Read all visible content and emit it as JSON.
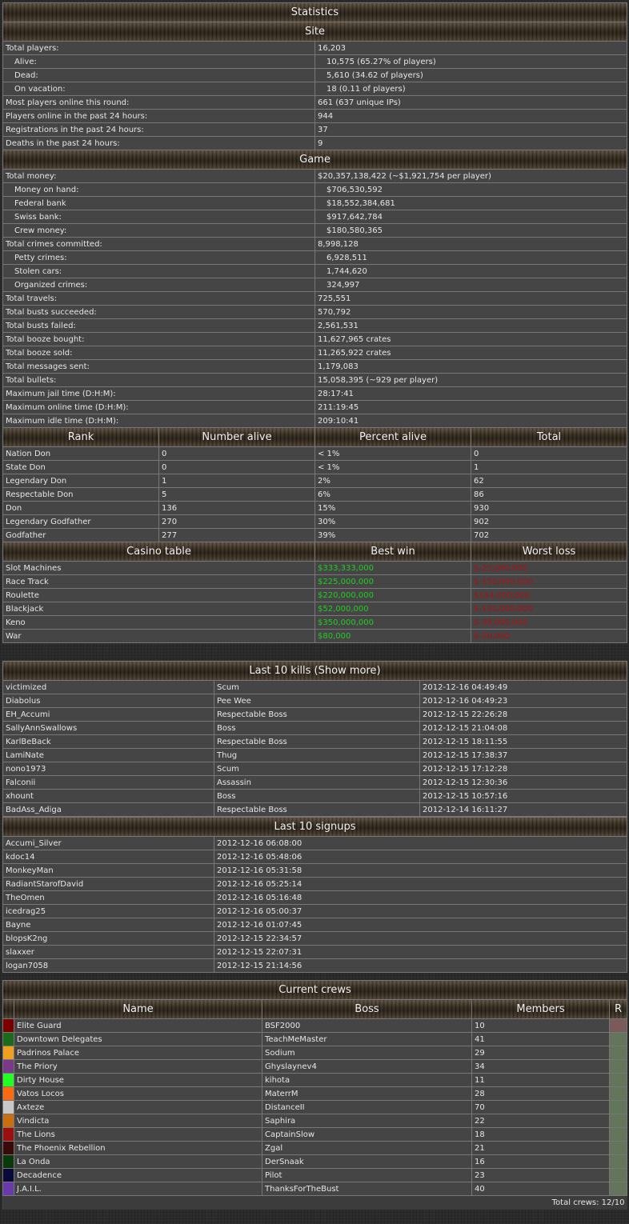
{
  "stats": {
    "title": "Statistics",
    "site_title": "Site",
    "site_rows": [
      {
        "label": "Total players:",
        "value": "16,203",
        "indent": false
      },
      {
        "label": "Alive:",
        "value": "10,575 (65.27% of players)",
        "indent": true
      },
      {
        "label": "Dead:",
        "value": "5,610 (34.62 of players)",
        "indent": true
      },
      {
        "label": "On vacation:",
        "value": "18 (0.11 of players)",
        "indent": true
      },
      {
        "label": "Most players online this round:",
        "value": "661 (637 unique IPs)",
        "indent": false
      },
      {
        "label": "Players online in the past 24 hours:",
        "value": "944",
        "indent": false
      },
      {
        "label": "Registrations in the past 24 hours:",
        "value": "37",
        "indent": false
      },
      {
        "label": "Deaths in the past 24 hours:",
        "value": "9",
        "indent": false
      }
    ],
    "game_title": "Game",
    "game_rows": [
      {
        "label": "Total money:",
        "value": "$20,357,138,422 (~$1,921,754 per player)",
        "indent": false
      },
      {
        "label": "Money on hand:",
        "value": "$706,530,592",
        "indent": true
      },
      {
        "label": "Federal bank",
        "value": "$18,552,384,681",
        "indent": true
      },
      {
        "label": "Swiss bank:",
        "value": "$917,642,784",
        "indent": true
      },
      {
        "label": "Crew money:",
        "value": "$180,580,365",
        "indent": true
      },
      {
        "label": "Total crimes committed:",
        "value": "8,998,128",
        "indent": false
      },
      {
        "label": "Petty crimes:",
        "value": "6,928,511",
        "indent": true
      },
      {
        "label": "Stolen cars:",
        "value": "1,744,620",
        "indent": true
      },
      {
        "label": "Organized crimes:",
        "value": "324,997",
        "indent": true
      },
      {
        "label": "Total travels:",
        "value": "725,551",
        "indent": false
      },
      {
        "label": "Total busts succeeded:",
        "value": "570,792",
        "indent": false
      },
      {
        "label": "Total busts failed:",
        "value": "2,561,531",
        "indent": false
      },
      {
        "label": "Total booze bought:",
        "value": "11,627,965 crates",
        "indent": false
      },
      {
        "label": "Total booze sold:",
        "value": "11,265,922 crates",
        "indent": false
      },
      {
        "label": "Total messages sent:",
        "value": "1,179,083",
        "indent": false
      },
      {
        "label": "Total bullets:",
        "value": "15,058,395 (~929 per player)",
        "indent": false
      },
      {
        "label": "Maximum jail time (D:H:M):",
        "value": "28:17:41",
        "indent": false
      },
      {
        "label": "Maximum online time (D:H:M):",
        "value": "211:19:45",
        "indent": false
      },
      {
        "label": "Maximum idle time (D:H:M):",
        "value": "209:10:41",
        "indent": false
      }
    ],
    "rank_headers": [
      "Rank",
      "Number alive",
      "Percent alive",
      "Total"
    ],
    "rank_rows": [
      [
        "Nation Don",
        "0",
        "< 1%",
        "0"
      ],
      [
        "State Don",
        "0",
        "< 1%",
        "1"
      ],
      [
        "Legendary Don",
        "1",
        "2%",
        "62"
      ],
      [
        "Respectable Don",
        "5",
        "6%",
        "86"
      ],
      [
        "Don",
        "136",
        "15%",
        "930"
      ],
      [
        "Legendary Godfather",
        "270",
        "30%",
        "902"
      ],
      [
        "Godfather",
        "277",
        "39%",
        "702"
      ]
    ],
    "casino_headers": [
      "Casino table",
      "Best win",
      "Worst loss"
    ],
    "casino_rows": [
      [
        "Slot Machines",
        "$333,333,000",
        "$-25,000,000"
      ],
      [
        "Race Track",
        "$225,000,000",
        "$-150,000,000"
      ],
      [
        "Roulette",
        "$220,000,000",
        "$164,000,000"
      ],
      [
        "Blackjack",
        "$52,000,000",
        "$-150,000,000"
      ],
      [
        "Keno",
        "$350,000,000",
        "$-39,000,000"
      ],
      [
        "War",
        "$80,000",
        "$-20,000"
      ]
    ]
  },
  "kills": {
    "title": "Last 10 kills (Show more)",
    "rows": [
      [
        "victimized",
        "Scum",
        "2012-12-16 04:49:49"
      ],
      [
        "Diabolus",
        "Pee Wee",
        "2012-12-16 04:49:23"
      ],
      [
        "EH_Accumi",
        "Respectable Boss",
        "2012-12-15 22:26:28"
      ],
      [
        "SallyAnnSwallows",
        "Boss",
        "2012-12-15 21:04:08"
      ],
      [
        "KarlBeBack",
        "Respectable Boss",
        "2012-12-15 18:11:55"
      ],
      [
        "LamiNate",
        "Thug",
        "2012-12-15 17:38:37"
      ],
      [
        "nono1973",
        "Scum",
        "2012-12-15 17:12:28"
      ],
      [
        "Falconii",
        "Assassin",
        "2012-12-15 12:30:36"
      ],
      [
        "xhount",
        "Boss",
        "2012-12-15 10:57:16"
      ],
      [
        "BadAss_Adiga",
        "Respectable Boss",
        "2012-12-14 16:11:27"
      ]
    ]
  },
  "signups": {
    "title": "Last 10 signups",
    "rows": [
      [
        "Accumi_Silver",
        "2012-12-16 06:08:00"
      ],
      [
        "kdoc14",
        "2012-12-16 05:48:06"
      ],
      [
        "MonkeyMan",
        "2012-12-16 05:31:58"
      ],
      [
        "RadiantStarofDavid",
        "2012-12-16 05:25:14"
      ],
      [
        "TheOmen",
        "2012-12-16 05:16:48"
      ],
      [
        "icedrag25",
        "2012-12-16 05:00:37"
      ],
      [
        "Bayne",
        "2012-12-16 01:07:45"
      ],
      [
        "blopsK2ng",
        "2012-12-15 22:34:57"
      ],
      [
        "slaxxer",
        "2012-12-15 22:07:31"
      ],
      [
        "logan7058",
        "2012-12-15 21:14:56"
      ]
    ]
  },
  "crews": {
    "title": "Current crews",
    "headers": [
      "Name",
      "Boss",
      "Members",
      "R"
    ],
    "rows": [
      {
        "color": "#7a0000",
        "name": "Elite Guard",
        "boss": "BSF2000",
        "members": "10"
      },
      {
        "color": "#1a6b1a",
        "name": "Downtown Delegates",
        "boss": "TeachMeMaster",
        "members": "41"
      },
      {
        "color": "#f0a020",
        "name": "Padrinos Palace",
        "boss": "Sodium",
        "members": "29"
      },
      {
        "color": "#7a3a8a",
        "name": "The Priory",
        "boss": "Ghyslaynev4",
        "members": "34"
      },
      {
        "color": "#22ff22",
        "name": "Dirty House",
        "boss": "kihota",
        "members": "11"
      },
      {
        "color": "#ff6a10",
        "name": "Vatos Locos",
        "boss": "MaterrM",
        "members": "28"
      },
      {
        "color": "#c8c8c8",
        "name": "Axteze",
        "boss": "DistanceII",
        "members": "70"
      },
      {
        "color": "#c87010",
        "name": "Vindicta",
        "boss": "Saphira",
        "members": "22"
      },
      {
        "color": "#9a1010",
        "name": "The Lions",
        "boss": "CaptainSlow",
        "members": "18"
      },
      {
        "color": "#3a0a0a",
        "name": "The Phoenix Rebellion",
        "boss": "Zgal",
        "members": "21"
      },
      {
        "color": "#0a3a0a",
        "name": "La Onda",
        "boss": "DerSnaak",
        "members": "16"
      },
      {
        "color": "#0a0a3a",
        "name": "Decadence",
        "boss": "Pilot",
        "members": "23"
      },
      {
        "color": "#6a3aaa",
        "name": "J.A.I.L.",
        "boss": "ThanksForTheBust",
        "members": "40"
      }
    ],
    "total": "Total crews: 12/10"
  }
}
